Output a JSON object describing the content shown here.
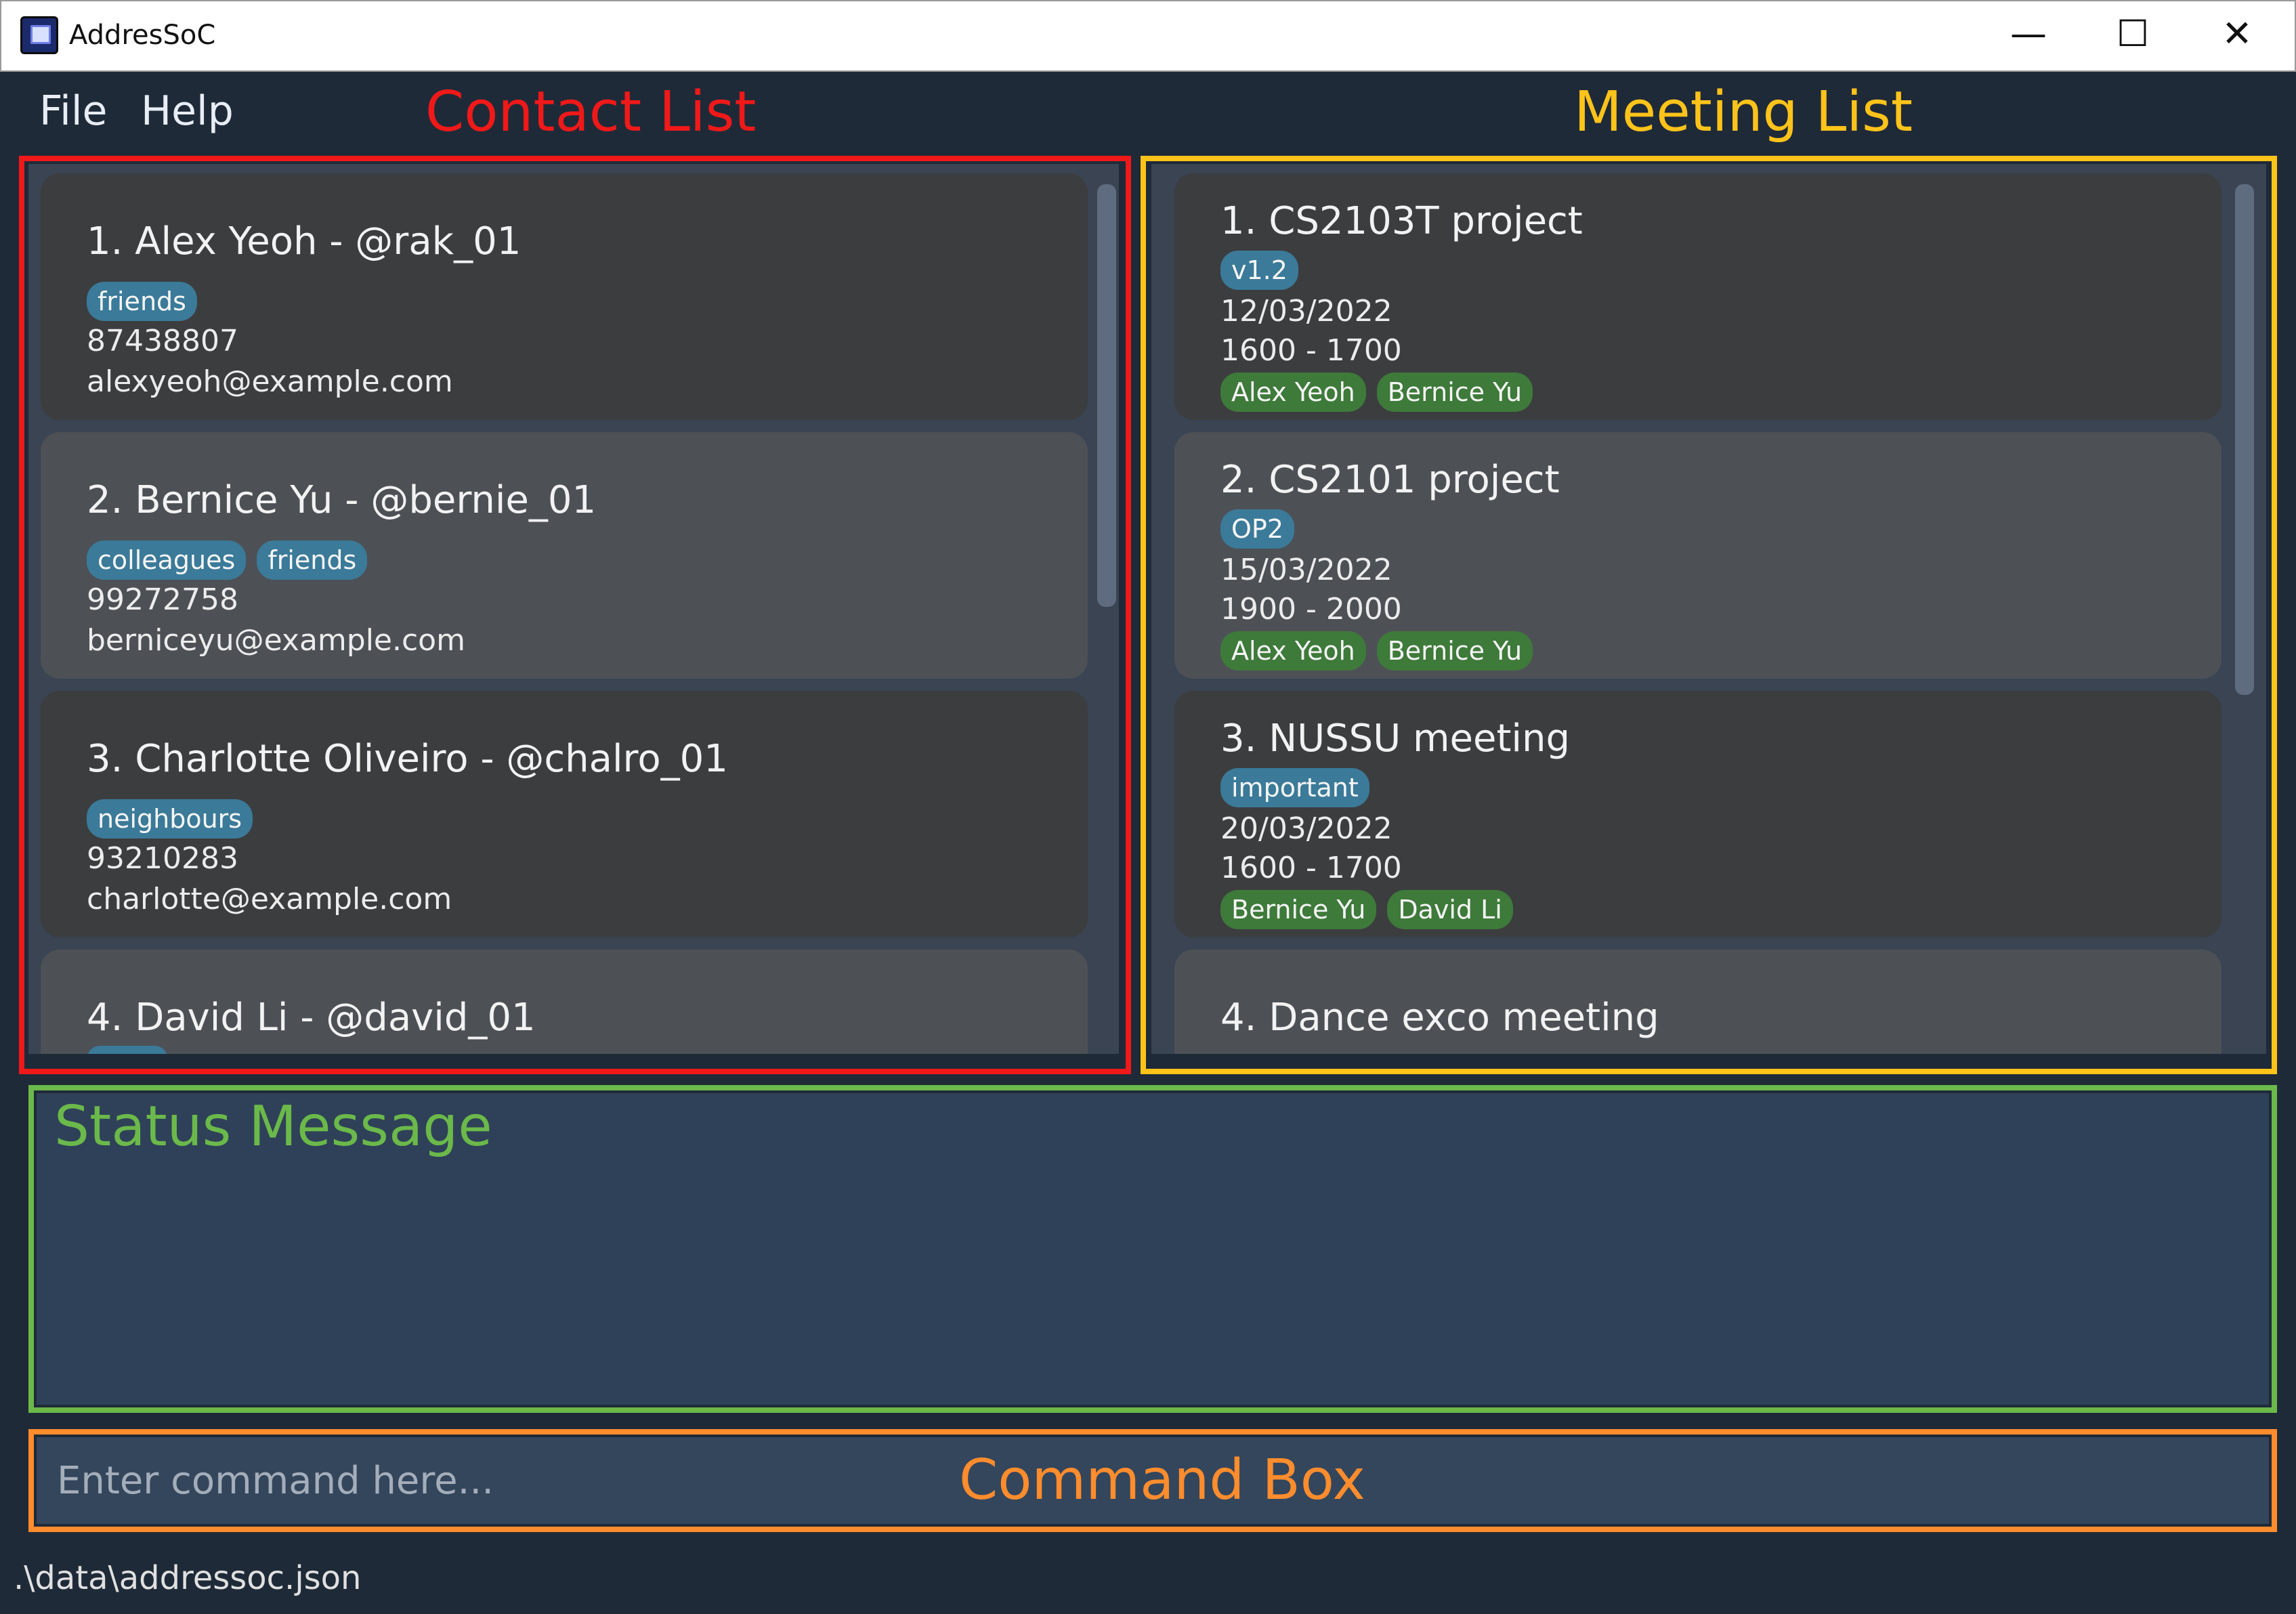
{
  "window": {
    "title": "AddresSoC",
    "minimize": "—",
    "maximize": "☐",
    "close": "✕"
  },
  "menu": {
    "file": "File",
    "help": "Help"
  },
  "annotations": {
    "contact_list": "Contact List",
    "meeting_list": "Meeting List",
    "status_message": "Status Message",
    "command_box": "Command Box"
  },
  "contacts": [
    {
      "title": "1.  Alex Yeoh - @rak_01",
      "tags": [
        "friends"
      ],
      "phone": "87438807",
      "email": "alexyeoh@example.com"
    },
    {
      "title": "2.  Bernice Yu - @bernie_01",
      "tags": [
        "colleagues",
        "friends"
      ],
      "phone": "99272758",
      "email": "berniceyu@example.com"
    },
    {
      "title": "3.  Charlotte Oliveiro - @chalro_01",
      "tags": [
        "neighbours"
      ],
      "phone": "93210283",
      "email": "charlotte@example.com"
    },
    {
      "title": "4.  David Li - @david_01"
    }
  ],
  "meetings": [
    {
      "title": "1.  CS2103T project",
      "tags": [
        "v1.2"
      ],
      "date": "12/03/2022",
      "time": "1600 - 1700",
      "participants": [
        "Alex Yeoh",
        "Bernice Yu"
      ]
    },
    {
      "title": "2.  CS2101 project",
      "tags": [
        "OP2"
      ],
      "date": "15/03/2022",
      "time": "1900 - 2000",
      "participants": [
        "Alex Yeoh",
        "Bernice Yu"
      ]
    },
    {
      "title": "3.  NUSSU meeting",
      "tags": [
        "important"
      ],
      "date": "20/03/2022",
      "time": "1600 - 1700",
      "participants": [
        "Bernice Yu",
        "David Li"
      ]
    },
    {
      "title": "4.  Dance exco meeting"
    }
  ],
  "command": {
    "placeholder": "Enter command here...",
    "value": ""
  },
  "status": {
    "message": ""
  },
  "footer": {
    "path": ".\\data\\addressoc.json"
  },
  "colors": {
    "contact_box": "#f01919",
    "meeting_box": "#ffc31a",
    "status_box": "#6bb94a",
    "command_box": "#ff8c2d",
    "tag_blue": "#3b7a99",
    "tag_green": "#3e7a3a"
  }
}
